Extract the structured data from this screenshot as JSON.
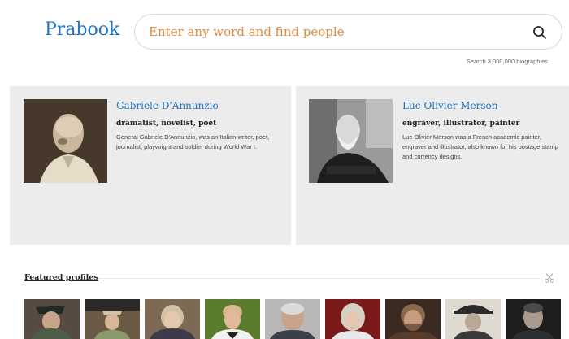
{
  "header": {
    "logo": "Prabook",
    "search_placeholder": "Enter any word and find people",
    "search_hint": "Search 3,000,000 biographies"
  },
  "cards": [
    {
      "name": "Gabriele D'Annunzio",
      "professions": "dramatist, novelist, poet",
      "description": "General Gabriele D'Annunzio, was an Italian writer, poet, journalist, playwright and soldier during World War I."
    },
    {
      "name": "Luc-Olivier Merson",
      "professions": "engraver, illustrator, painter",
      "description": "Luc-Olivier Merson was a French academic painter, engraver and illustrator, also known for his postage stamp and currency designs."
    }
  ],
  "featured": {
    "title": "Featured profiles"
  },
  "colors": {
    "link": "#1f73c4",
    "placeholder": "#e08b3f",
    "card_bg": "#ececec"
  },
  "icons": [
    "search-icon",
    "scissors-icon"
  ]
}
